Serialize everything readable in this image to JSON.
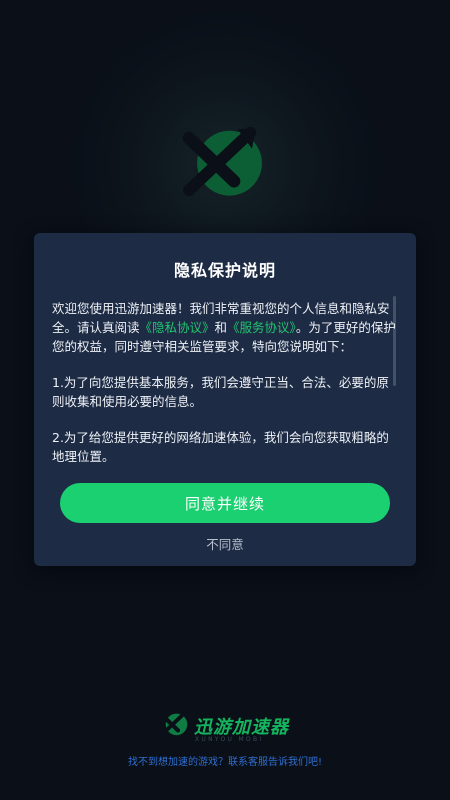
{
  "dialog": {
    "title": "隐私保护说明",
    "intro_part1": "欢迎您使用迅游加速器！我们非常重视您的个人信息和隐私安全。请认真阅读",
    "privacy_link": "《隐私协议》",
    "and": "和",
    "service_link": "《服务协议》",
    "intro_part2": "。为了更好的保护您的权益，同时遵守相关监管要求，特向您说明如下：",
    "item1": "1.为了向您提供基本服务，我们会遵守正当、合法、必要的原则收集和使用必要的信息。",
    "item2": "2.为了给您提供更好的网络加速体验，我们会向您获取粗略的地理位置。",
    "agree_button": "同意并继续",
    "disagree_button": "不同意"
  },
  "brand": {
    "name": "迅游加速器",
    "subtitle": "XUNYOU MOBI"
  },
  "footer": {
    "text": "找不到想加速的游戏？联系客服告诉我们吧!"
  },
  "colors": {
    "accent": "#1bd071",
    "link": "#22c46e",
    "dialog_bg": "#1d2b45",
    "page_bg": "#0a0f18"
  }
}
